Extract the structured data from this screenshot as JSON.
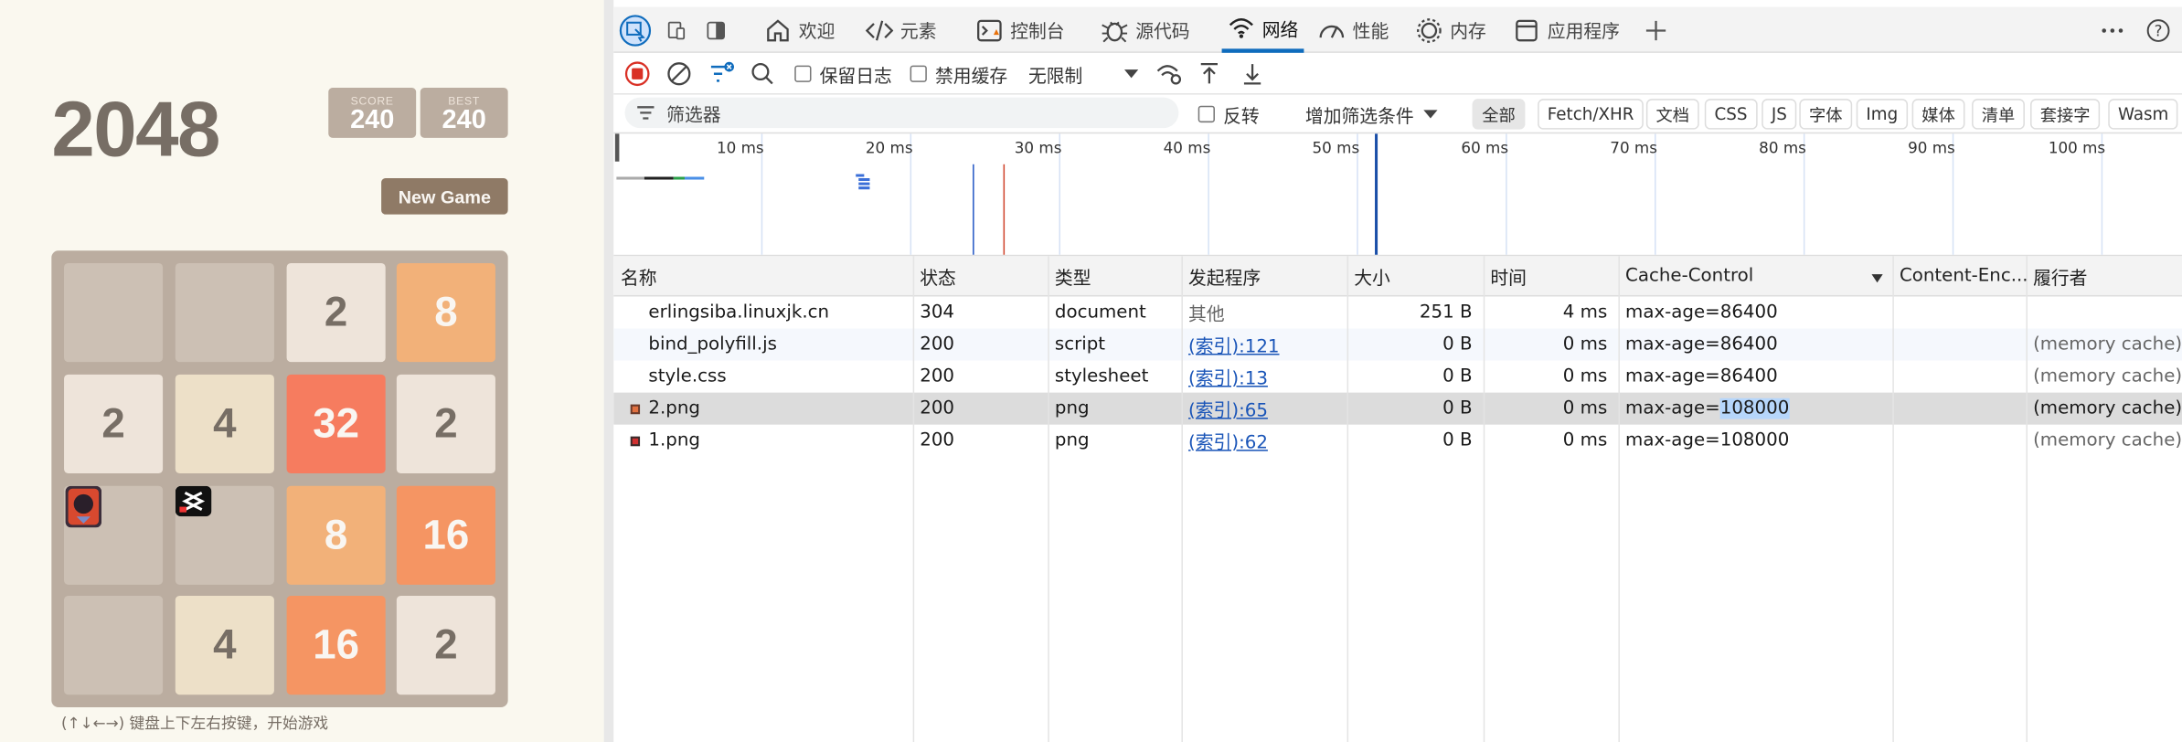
{
  "game": {
    "title": "2048",
    "score_label": "SCORE",
    "score": "240",
    "best_label": "BEST",
    "best": "240",
    "new_game": "New Game",
    "hint": "(↑↓←→) 键盘上下左右按键，开始游戏",
    "tiles": [
      [
        "",
        "",
        "2",
        "8"
      ],
      [
        "2",
        "4",
        "32",
        "2"
      ],
      [
        "",
        "",
        "8",
        "16"
      ],
      [
        "",
        "4",
        "16",
        "2"
      ]
    ]
  },
  "devtools": {
    "tabs": [
      "欢迎",
      "元素",
      "控制台",
      "源代码",
      "网络",
      "性能",
      "内存",
      "应用程序"
    ],
    "active_tab": "网络",
    "toolbar": {
      "preserve_log": "保留日志",
      "disable_cache": "禁用缓存",
      "throttle": "无限制"
    },
    "filter": {
      "placeholder": "筛选器",
      "invert": "反转",
      "more_filters": "增加筛选条件",
      "types": [
        "全部",
        "Fetch/XHR",
        "文档",
        "CSS",
        "JS",
        "字体",
        "Img",
        "媒体",
        "清单",
        "套接字",
        "Wasm"
      ]
    },
    "timeline_ticks": [
      "10 ms",
      "20 ms",
      "30 ms",
      "40 ms",
      "50 ms",
      "60 ms",
      "70 ms",
      "80 ms",
      "90 ms",
      "100 ms"
    ],
    "columns": [
      "名称",
      "状态",
      "类型",
      "发起程序",
      "大小",
      "时间",
      "Cache-Control",
      "Content-Enc...",
      "履行者"
    ],
    "rows": [
      {
        "name": "erlingsiba.linuxjk.cn",
        "status": "304",
        "type": "document",
        "initiator": "其他",
        "size": "251 B",
        "time": "4 ms",
        "cache": "max-age=86400",
        "encoding": "",
        "fulfilled": ""
      },
      {
        "name": "bind_polyfill.js",
        "status": "200",
        "type": "script",
        "initiator": "(索引):121",
        "size": "0 B",
        "time": "0 ms",
        "cache": "max-age=86400",
        "encoding": "",
        "fulfilled": "(memory cache)"
      },
      {
        "name": "style.css",
        "status": "200",
        "type": "stylesheet",
        "initiator": "(索引):13",
        "size": "0 B",
        "time": "0 ms",
        "cache": "max-age=86400",
        "encoding": "",
        "fulfilled": "(memory cache)"
      },
      {
        "name": "2.png",
        "status": "200",
        "type": "png",
        "initiator": "(索引):65",
        "size": "0 B",
        "time": "0 ms",
        "cache_prefix": "max-age=",
        "cache_value": "108000",
        "encoding": "",
        "fulfilled": "(memory cache)"
      },
      {
        "name": "1.png",
        "status": "200",
        "type": "png",
        "initiator": "(索引):62",
        "size": "0 B",
        "time": "0 ms",
        "cache": "max-age=108000",
        "encoding": "",
        "fulfilled": "(memory cache)"
      }
    ]
  },
  "colors": {
    "accent": "#0f6cbd",
    "record_red": "#d93025",
    "link": "#1a55b8",
    "selection": "#b6d6fb"
  }
}
